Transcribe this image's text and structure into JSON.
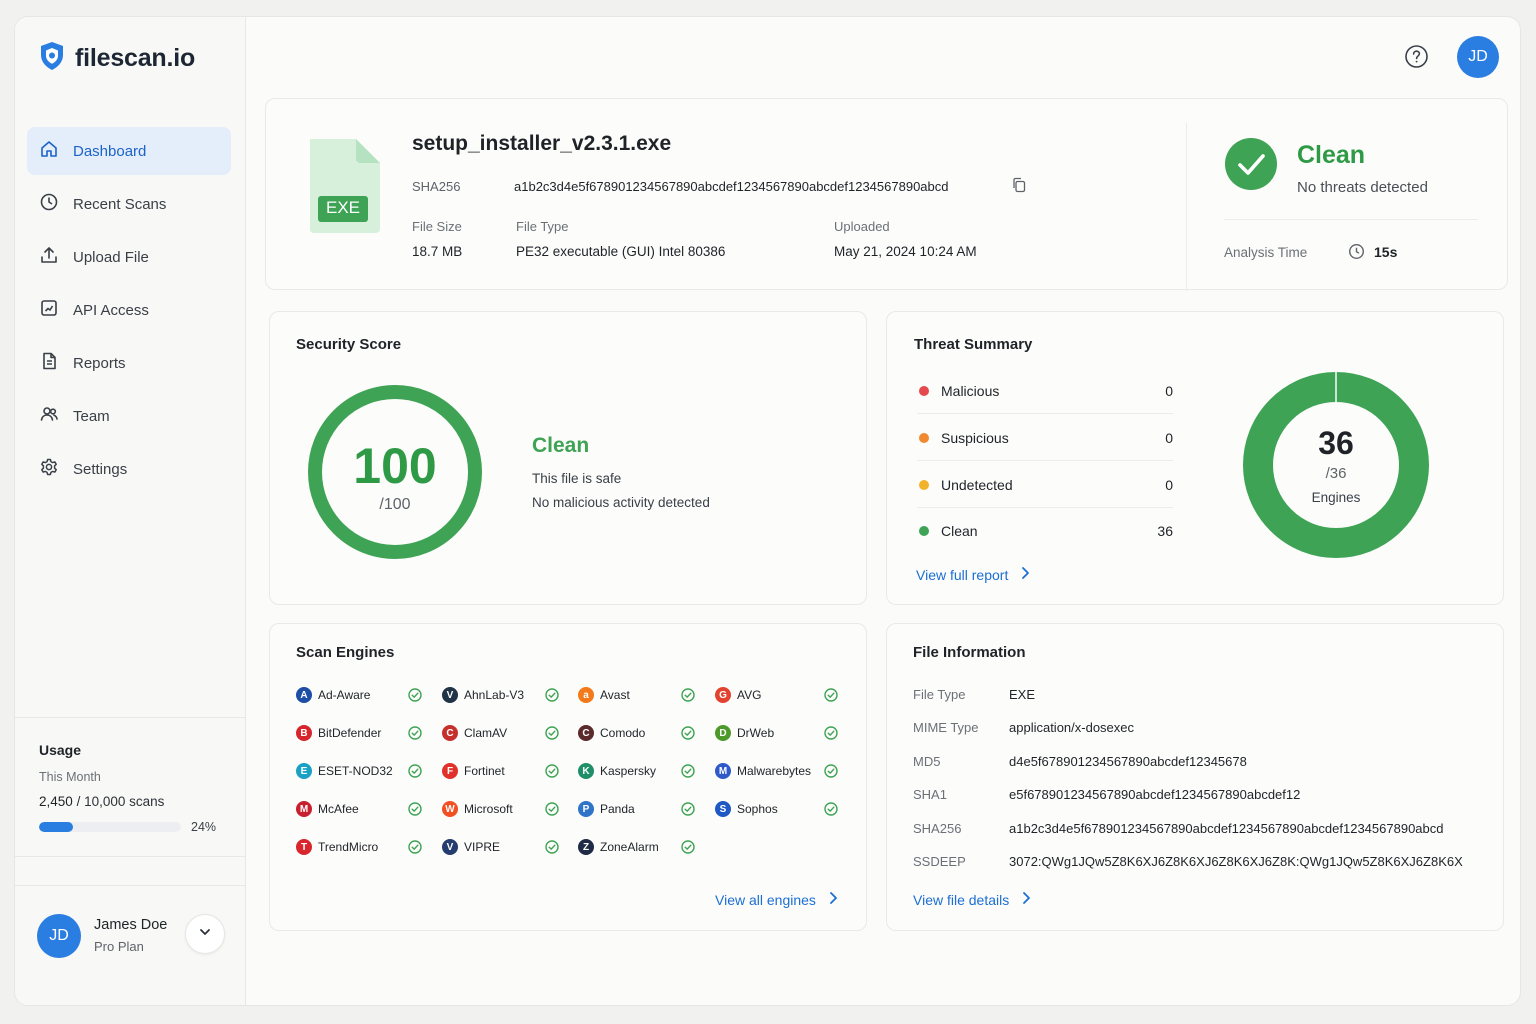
{
  "brand": {
    "name": "filescan.io"
  },
  "nav": {
    "items": [
      {
        "label": "Dashboard",
        "icon": "home-icon"
      },
      {
        "label": "Recent Scans",
        "icon": "clock-icon"
      },
      {
        "label": "Upload File",
        "icon": "upload-icon"
      },
      {
        "label": "API Access",
        "icon": "api-icon"
      },
      {
        "label": "Reports",
        "icon": "report-icon"
      },
      {
        "label": "Team",
        "icon": "team-icon"
      },
      {
        "label": "Settings",
        "icon": "gear-icon"
      }
    ],
    "active": "Dashboard"
  },
  "usage": {
    "title": "Usage",
    "period": "This Month",
    "used": "2,450",
    "total": "/ 10,000 scans",
    "percent": "24%",
    "fraction": 0.24
  },
  "user": {
    "initials": "JD",
    "name": "James Doe",
    "plan": "Pro Plan"
  },
  "header": {
    "avatar_initials": "JD"
  },
  "file": {
    "badge": "EXE",
    "name": "setup_installer_v2.3.1.exe",
    "sha_label": "SHA256",
    "sha_value": "a1b2c3d4e5f678901234567890abcdef1234567890abcdef1234567890abcd",
    "size_label": "File Size",
    "size_value": "18.7 MB",
    "type_label": "File Type",
    "type_value": "PE32 executable (GUI) Intel 80386",
    "uploaded_label": "Uploaded",
    "uploaded_value": "May 21, 2024 10:24 AM"
  },
  "verdict": {
    "title": "Clean",
    "subtitle": "No threats detected",
    "analysis_label": "Analysis Time",
    "analysis_value": "15s"
  },
  "score": {
    "title": "Security Score",
    "value": "100",
    "max": "/100",
    "verdict": "Clean",
    "line1": "This file is safe",
    "line2": "No malicious activity detected"
  },
  "threats": {
    "title": "Threat Summary",
    "rows": [
      {
        "label": "Malicious",
        "count": "0",
        "color": "#e5484d"
      },
      {
        "label": "Suspicious",
        "count": "0",
        "color": "#f0892f"
      },
      {
        "label": "Undetected",
        "count": "0",
        "color": "#f2b22a"
      },
      {
        "label": "Clean",
        "count": "36",
        "color": "#3ea354"
      }
    ],
    "link": "View full report",
    "donut_value": "36",
    "donut_total": "/36",
    "donut_label": "Engines"
  },
  "engines": {
    "title": "Scan Engines",
    "items": [
      {
        "name": "Ad-Aware",
        "color": "#1d4fa6",
        "glyph": "A"
      },
      {
        "name": "AhnLab-V3",
        "color": "#203347",
        "glyph": "V"
      },
      {
        "name": "Avast",
        "color": "#f27a1a",
        "glyph": "a"
      },
      {
        "name": "AVG",
        "color": "#e2432f",
        "glyph": "G"
      },
      {
        "name": "BitDefender",
        "color": "#d6262c",
        "glyph": "B"
      },
      {
        "name": "ClamAV",
        "color": "#c4312c",
        "glyph": "C"
      },
      {
        "name": "Comodo",
        "color": "#5b2a2a",
        "glyph": "C"
      },
      {
        "name": "DrWeb",
        "color": "#4d9a2a",
        "glyph": "D"
      },
      {
        "name": "ESET-NOD32",
        "color": "#1aa1c4",
        "glyph": "E"
      },
      {
        "name": "Fortinet",
        "color": "#e0312b",
        "glyph": "F"
      },
      {
        "name": "Kaspersky",
        "color": "#1f8f6a",
        "glyph": "K"
      },
      {
        "name": "Malwarebytes",
        "color": "#2f58c9",
        "glyph": "M"
      },
      {
        "name": "McAfee",
        "color": "#c8202f",
        "glyph": "M"
      },
      {
        "name": "Microsoft",
        "color": "#f25022",
        "glyph": "W"
      },
      {
        "name": "Panda",
        "color": "#2f74c9",
        "glyph": "P"
      },
      {
        "name": "Sophos",
        "color": "#2059c4",
        "glyph": "S"
      },
      {
        "name": "TrendMicro",
        "color": "#d8262c",
        "glyph": "T"
      },
      {
        "name": "VIPRE",
        "color": "#253c6e",
        "glyph": "V"
      },
      {
        "name": "ZoneAlarm",
        "color": "#1f2b45",
        "glyph": "Z"
      }
    ],
    "link": "View all engines"
  },
  "info": {
    "title": "File Information",
    "rows": [
      {
        "label": "File Type",
        "value": "EXE"
      },
      {
        "label": "MIME Type",
        "value": "application/x-dosexec"
      },
      {
        "label": "MD5",
        "value": "d4e5f678901234567890abcdef12345678"
      },
      {
        "label": "SHA1",
        "value": "e5f678901234567890abcdef1234567890abcdef12"
      },
      {
        "label": "SHA256",
        "value": "a1b2c3d4e5f678901234567890abcdef1234567890abcdef1234567890abcd"
      },
      {
        "label": "SSDEEP",
        "value": "3072:QWg1JQw5Z8K6XJ6Z8K6XJ6Z8K6XJ6Z8K:QWg1JQw5Z8K6XJ6Z8K6X"
      }
    ],
    "link": "View file details"
  },
  "colors": {
    "accent": "#2a7de1",
    "success": "#3ea354",
    "link": "#1b6fd3"
  }
}
